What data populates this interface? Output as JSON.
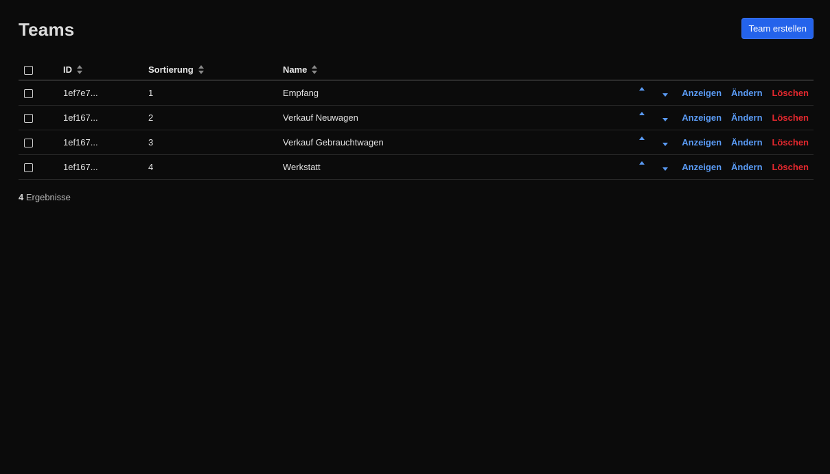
{
  "page": {
    "title": "Teams",
    "create_button_label": "Team erstellen"
  },
  "table": {
    "columns": [
      {
        "label": "ID",
        "sortable": true
      },
      {
        "label": "Sortierung",
        "sortable": true
      },
      {
        "label": "Name",
        "sortable": true
      }
    ],
    "rows": [
      {
        "id": "1ef7e7...",
        "sort": "1",
        "name": "Empfang"
      },
      {
        "id": "1ef167...",
        "sort": "2",
        "name": "Verkauf Neuwagen"
      },
      {
        "id": "1ef167...",
        "sort": "3",
        "name": "Verkauf Gebrauchtwagen"
      },
      {
        "id": "1ef167...",
        "sort": "4",
        "name": "Werkstatt"
      }
    ],
    "actions": {
      "move_up_icon": "caret-up-icon",
      "move_down_icon": "caret-down-icon",
      "show_label": "Anzeigen",
      "edit_label": "Ändern",
      "delete_label": "Löschen"
    }
  },
  "footer": {
    "count": "4",
    "count_label": "Ergebnisse"
  },
  "colors": {
    "background": "#0b0b0b",
    "primary_button": "#2463eb",
    "link_blue": "#5a9bf5",
    "delete_red": "#e5282e"
  }
}
